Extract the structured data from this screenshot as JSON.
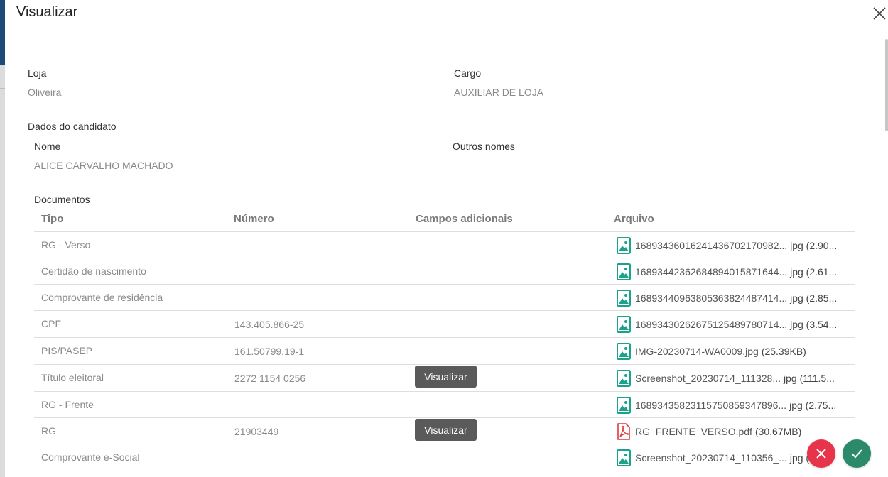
{
  "dialog": {
    "title": "Visualizar"
  },
  "loja": {
    "label": "Loja",
    "value": "Oliveira"
  },
  "cargo": {
    "label": "Cargo",
    "value": "AUXILIAR DE LOJA"
  },
  "candidato": {
    "section_label": "Dados do candidato",
    "nome_label": "Nome",
    "nome_value": "ALICE CARVALHO MACHADO",
    "outros_nomes_label": "Outros nomes"
  },
  "documentos": {
    "section_label": "Documentos",
    "headers": {
      "tipo": "Tipo",
      "numero": "Número",
      "campos": "Campos adicionais",
      "arquivo": "Arquivo"
    },
    "rows": [
      {
        "tipo": "RG - Verso",
        "numero": "",
        "button": "",
        "file_name": "16893436016241436702170982...",
        "file_size": "jpg (2.90...",
        "file_icon": "image-file-icon"
      },
      {
        "tipo": "Certidão de nascimento",
        "numero": "",
        "button": "",
        "file_name": "16893442362684894015871644...",
        "file_size": "jpg (2.61...",
        "file_icon": "image-file-icon"
      },
      {
        "tipo": "Comprovante de residência",
        "numero": "",
        "button": "",
        "file_name": "16893440963805363824487414...",
        "file_size": "jpg (2.85...",
        "file_icon": "image-file-icon"
      },
      {
        "tipo": "CPF",
        "numero": "143.405.866-25",
        "button": "",
        "file_name": "16893430262675125489780714...",
        "file_size": "jpg (3.54...",
        "file_icon": "image-file-icon"
      },
      {
        "tipo": "PIS/PASEP",
        "numero": "161.50799.19-1",
        "button": "",
        "file_name": "IMG-20230714-WA0009.jpg",
        "file_size": "(25.39KB)",
        "file_icon": "image-file-icon"
      },
      {
        "tipo": "Título eleitoral",
        "numero": "2272 1154 0256",
        "button": "Visualizar",
        "file_name": "Screenshot_20230714_111328...",
        "file_size": "jpg (111.5...",
        "file_icon": "image-file-icon"
      },
      {
        "tipo": "RG - Frente",
        "numero": "",
        "button": "",
        "file_name": "16893435823115750859347896...",
        "file_size": "jpg (2.75...",
        "file_icon": "image-file-icon"
      },
      {
        "tipo": "RG",
        "numero": "21903449",
        "button": "Visualizar",
        "file_name": "RG_FRENTE_VERSO.pdf",
        "file_size": "(30.67MB)",
        "file_icon": "pdf-file-icon"
      },
      {
        "tipo": "Comprovante e-Social",
        "numero": "",
        "button": "",
        "file_name": "Screenshot_20230714_110356_...",
        "file_size": "jpg (",
        "file_icon": "image-file-icon"
      }
    ]
  },
  "colors": {
    "cancel": "#e8344a",
    "confirm": "#2a8a6a",
    "image_icon": "#1aa38a",
    "pdf_icon": "#e03a3a"
  }
}
